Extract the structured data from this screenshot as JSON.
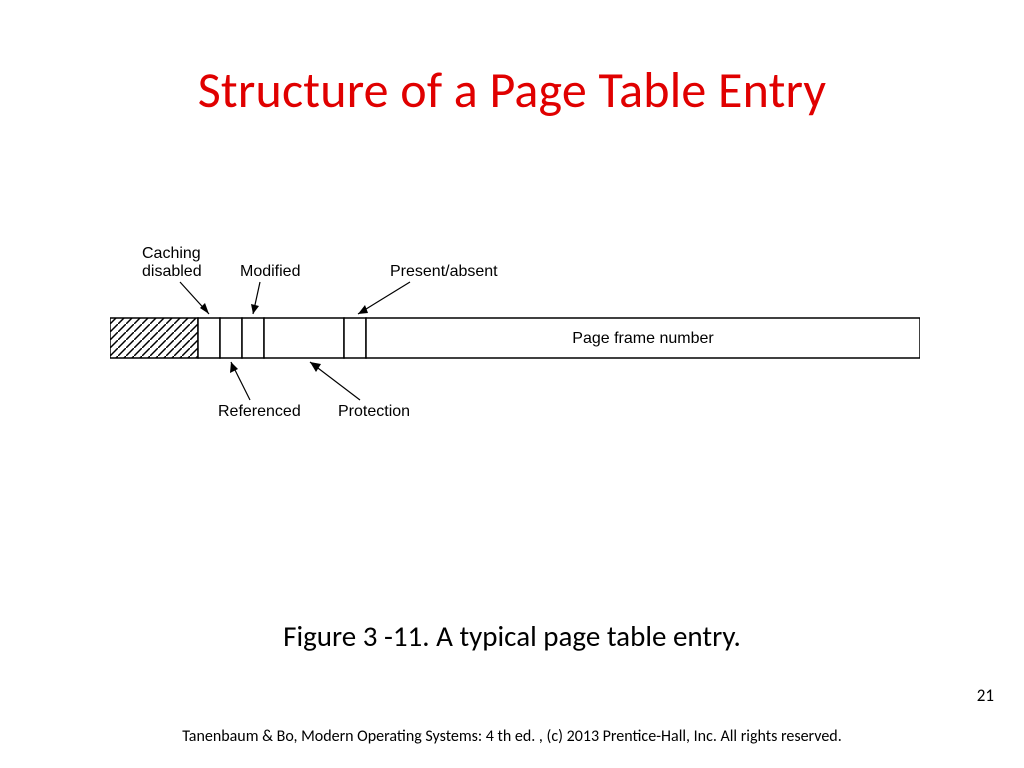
{
  "title": "Structure of a Page Table Entry",
  "caption": "Figure 3 -11. A typical page table entry.",
  "page_number": "21",
  "footer": "Tanenbaum & Bo, Modern  Operating Systems: 4 th ed. , (c) 2013 Prentice-Hall, Inc. All rights reserved.",
  "diagram": {
    "top_labels": {
      "caching_line1": "Caching",
      "caching_line2": "disabled",
      "modified": "Modified",
      "present_absent": "Present/absent"
    },
    "bottom_labels": {
      "referenced": "Referenced",
      "protection": "Protection"
    },
    "main_field": "Page frame number"
  }
}
